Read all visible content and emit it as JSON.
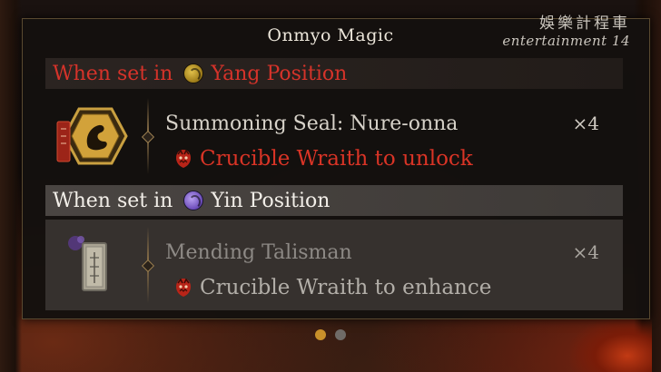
{
  "panel": {
    "title": "Onmyo Magic"
  },
  "watermark": {
    "chinese": "娛樂計程車",
    "english": "entertainment 14"
  },
  "yang_section": {
    "prefix": "When set in",
    "position": "Yang Position",
    "icon": "yin-yang-yang-icon",
    "color": "#d5332a",
    "item": {
      "name": "Summoning Seal: Nure-onna",
      "count": "×4",
      "requirement": "Crucible Wraith to unlock",
      "icon": "summoning-seal-icon"
    }
  },
  "yin_section": {
    "prefix": "When set in",
    "position": "Yin Position",
    "icon": "yin-yang-yin-icon",
    "color": "#f2eee8",
    "item": {
      "name": "Mending Talisman",
      "count": "×4",
      "requirement": "Crucible Wraith to enhance",
      "icon": "mending-talisman-icon"
    }
  },
  "pagination": {
    "total_pages": 2,
    "active_page": 1,
    "active_color": "#c8902a",
    "inactive_color": "#6f6b67"
  }
}
